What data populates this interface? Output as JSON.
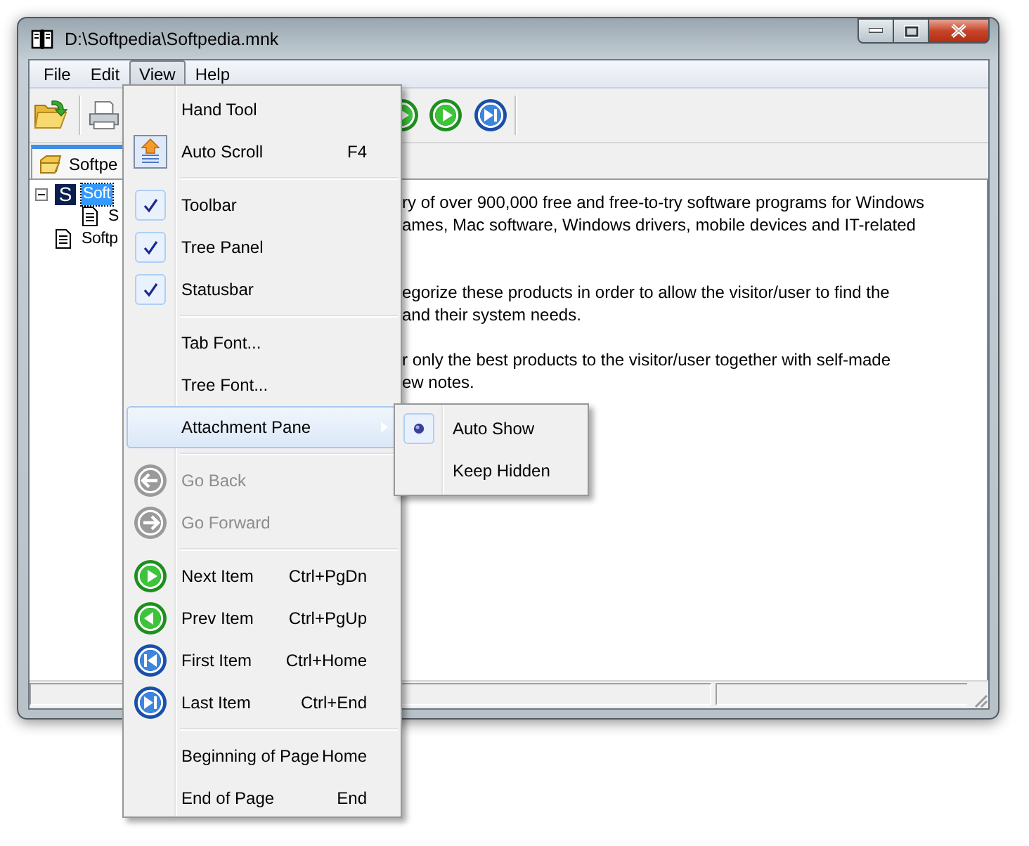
{
  "window": {
    "title": "D:\\Softpedia\\Softpedia.mnk"
  },
  "menubar": [
    {
      "label": "File",
      "selected": false
    },
    {
      "label": "Edit",
      "selected": false
    },
    {
      "label": "View",
      "selected": true
    },
    {
      "label": "Help",
      "selected": false
    }
  ],
  "tabs": [
    {
      "label": "Softpe",
      "selected": true
    }
  ],
  "tree": [
    {
      "label": "Soft",
      "badge": "S",
      "kind": "book",
      "selected": true,
      "expanded": true,
      "children": [
        {
          "label": "S",
          "kind": "page",
          "selected": false
        }
      ]
    },
    {
      "label": "Softp",
      "kind": "page",
      "selected": false
    }
  ],
  "document": {
    "paragraphs": [
      [
        "ry of over 900,000 free and free-to-try software programs for Windows",
        "ames, Mac software, Windows drivers, mobile devices and IT-related"
      ],
      [
        "egorize these products in order to allow the visitor/user to find the",
        "and their system needs."
      ],
      [
        "r only the best products to the visitor/user together with self-made",
        "ew notes."
      ]
    ]
  },
  "view_menu": {
    "items": [
      {
        "kind": "command",
        "label": "Hand Tool",
        "selected": false,
        "disabled": false
      },
      {
        "kind": "command",
        "label": "Auto Scroll",
        "shortcut": "F4",
        "selected": false,
        "disabled": false
      },
      {
        "kind": "separator"
      },
      {
        "kind": "check",
        "label": "Toolbar",
        "checked": true,
        "selected": false,
        "disabled": false
      },
      {
        "kind": "check",
        "label": "Tree Panel",
        "checked": true,
        "selected": false,
        "disabled": false
      },
      {
        "kind": "check",
        "label": "Statusbar",
        "checked": true,
        "selected": false,
        "disabled": false
      },
      {
        "kind": "separator"
      },
      {
        "kind": "command",
        "label": "Tab Font...",
        "selected": false,
        "disabled": false
      },
      {
        "kind": "command",
        "label": "Tree Font...",
        "selected": false,
        "disabled": false
      },
      {
        "kind": "submenu",
        "label": "Attachment Pane",
        "selected": true,
        "disabled": false
      },
      {
        "kind": "separator"
      },
      {
        "kind": "command",
        "label": "Go Back",
        "selected": false,
        "disabled": true
      },
      {
        "kind": "command",
        "label": "Go Forward",
        "selected": false,
        "disabled": true
      },
      {
        "kind": "separator"
      },
      {
        "kind": "command",
        "label": "Next Item",
        "shortcut": "Ctrl+PgDn",
        "selected": false,
        "disabled": false
      },
      {
        "kind": "command",
        "label": "Prev Item",
        "shortcut": "Ctrl+PgUp",
        "selected": false,
        "disabled": false
      },
      {
        "kind": "command",
        "label": "First Item",
        "shortcut": "Ctrl+Home",
        "selected": false,
        "disabled": false
      },
      {
        "kind": "command",
        "label": "Last Item",
        "shortcut": "Ctrl+End",
        "selected": false,
        "disabled": false
      },
      {
        "kind": "separator"
      },
      {
        "kind": "command",
        "label": "Beginning of Page",
        "shortcut": "Home",
        "selected": false,
        "disabled": false
      },
      {
        "kind": "command",
        "label": "End of Page",
        "shortcut": "End",
        "selected": false,
        "disabled": false
      }
    ]
  },
  "submenu": {
    "items": [
      {
        "label": "Auto Show",
        "selected": true
      },
      {
        "label": "Keep Hidden",
        "selected": false
      }
    ]
  }
}
